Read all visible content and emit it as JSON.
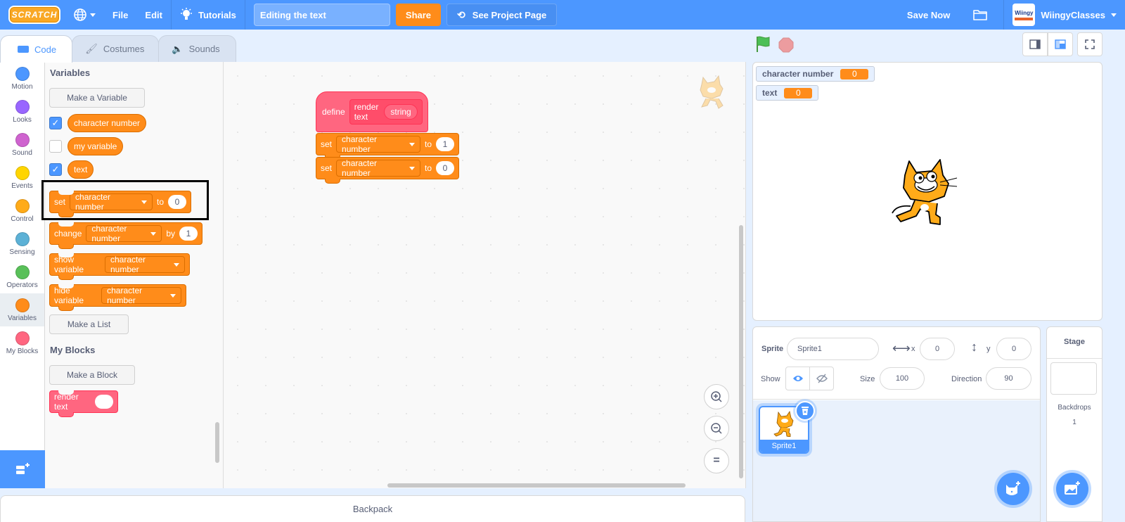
{
  "menubar": {
    "logo": "SCRATCH",
    "file": "File",
    "edit": "Edit",
    "tutorials": "Tutorials",
    "project_title": "Editing the text",
    "share": "Share",
    "see_project_page": "See Project Page",
    "save_now": "Save Now",
    "avatar_text": "Wiingy",
    "username": "WiingyClasses"
  },
  "tabs": [
    {
      "label": "Code"
    },
    {
      "label": "Costumes"
    },
    {
      "label": "Sounds"
    }
  ],
  "categories": [
    {
      "label": "Motion",
      "color": "#4c97ff"
    },
    {
      "label": "Looks",
      "color": "#9966ff"
    },
    {
      "label": "Sound",
      "color": "#cf63cf"
    },
    {
      "label": "Events",
      "color": "#ffd500"
    },
    {
      "label": "Control",
      "color": "#ffab19"
    },
    {
      "label": "Sensing",
      "color": "#5cb1d6"
    },
    {
      "label": "Operators",
      "color": "#59c059"
    },
    {
      "label": "Variables",
      "color": "#ff8c1a"
    },
    {
      "label": "My Blocks",
      "color": "#ff6680"
    }
  ],
  "palette": {
    "variables_heading": "Variables",
    "make_variable": "Make a Variable",
    "variables": [
      {
        "name": "character number",
        "checked": true
      },
      {
        "name": "my variable",
        "checked": false
      },
      {
        "name": "text",
        "checked": true
      }
    ],
    "set_block": {
      "label": "set",
      "var": "character number",
      "to": "to",
      "value": "0"
    },
    "change_block": {
      "label": "change",
      "var": "character number",
      "by": "by",
      "value": "1"
    },
    "show_block": {
      "label": "show variable",
      "var": "character number"
    },
    "hide_block": {
      "label": "hide variable",
      "var": "character number"
    },
    "make_list": "Make a List",
    "myblocks_heading": "My Blocks",
    "make_block": "Make a Block",
    "render_block": "render text"
  },
  "workspace": {
    "define": {
      "keyword": "define",
      "name": "render text",
      "param": "string"
    },
    "set1": {
      "label": "set",
      "var": "character number",
      "to": "to",
      "value": "1"
    },
    "set2": {
      "label": "set",
      "var": "character number",
      "to": "to",
      "value": "0"
    }
  },
  "backpack": "Backpack",
  "stage": {
    "monitors": [
      {
        "label": "character number",
        "value": "0"
      },
      {
        "label": "text",
        "value": "0"
      }
    ]
  },
  "sprite_info": {
    "sprite_label": "Sprite",
    "sprite_name": "Sprite1",
    "x_label": "x",
    "x": "0",
    "y_label": "y",
    "y": "0",
    "show_label": "Show",
    "size_label": "Size",
    "size": "100",
    "direction_label": "Direction",
    "direction": "90"
  },
  "sprites": [
    {
      "name": "Sprite1"
    }
  ],
  "stage_pane": {
    "title": "Stage",
    "backdrops_label": "Backdrops",
    "backdrops_count": "1"
  }
}
